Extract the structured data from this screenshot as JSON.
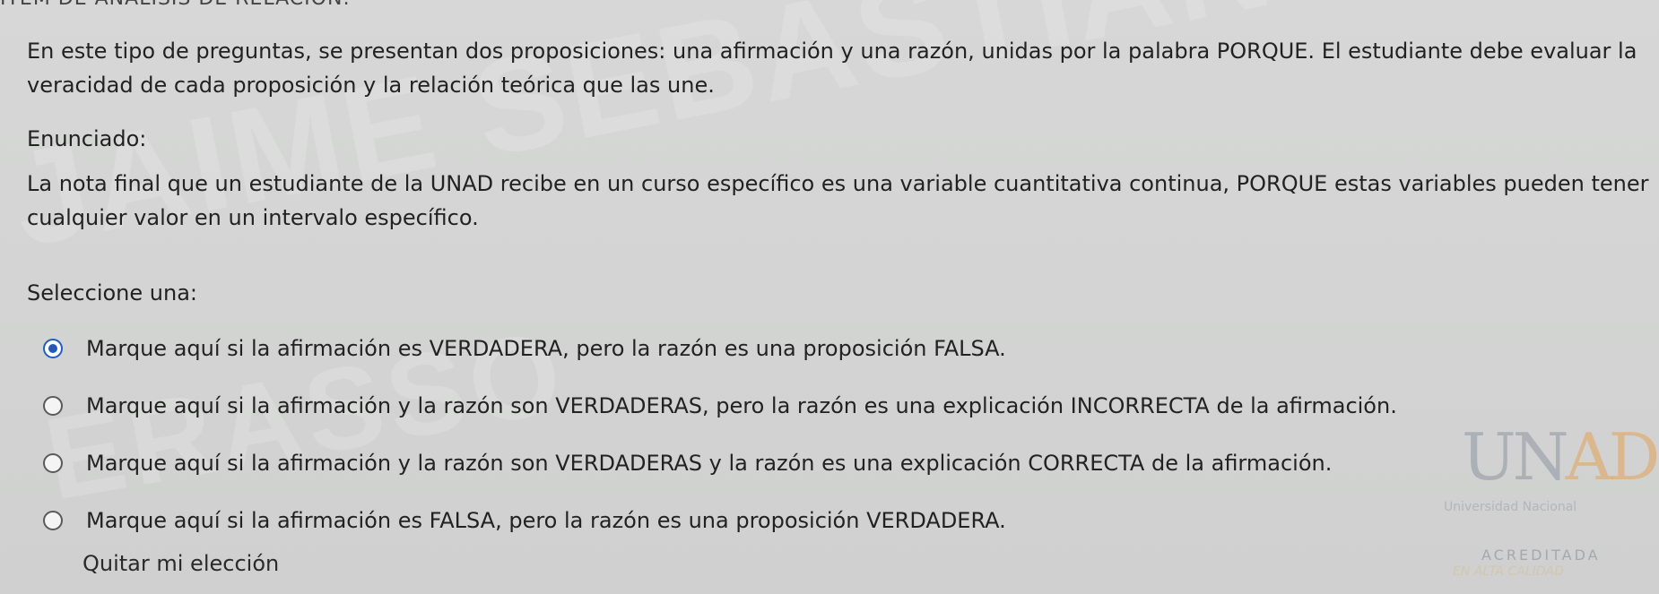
{
  "header": {
    "cut_title": "ÍTEM DE ANÁLISIS DE RELACIÓN:"
  },
  "intro_text": "En este tipo de preguntas, se presentan dos proposiciones: una afirmación y una razón, unidas por la palabra PORQUE. El estudiante debe evaluar la veracidad de cada proposición y la relación teórica que las une.",
  "enunciado_label": "Enunciado:",
  "statement": "La nota final que un estudiante de la UNAD recibe en un curso específico es una variable cuantitativa continua, PORQUE estas variables pueden tener cualquier valor en un intervalo específico.",
  "select_label": "Seleccione una:",
  "options": [
    {
      "label": "Marque aquí si la afirmación es VERDADERA, pero la razón es una proposición FALSA.",
      "selected": true
    },
    {
      "label": "Marque aquí si la afirmación y la razón son VERDADERAS, pero la razón es una explicación INCORRECTA de la afirmación.",
      "selected": false
    },
    {
      "label": "Marque aquí si la afirmación y la razón son VERDADERAS y la razón es una explicación CORRECTA de la afirmación.",
      "selected": false
    },
    {
      "label": "Marque aquí si la afirmación es FALSA, pero la razón es una proposición VERDADERA.",
      "selected": false
    }
  ],
  "clear_choice": "Quitar mi elección",
  "watermark": {
    "line1": "JAIME SEBASTIAN CASTILLO",
    "line2": "ERASSO"
  },
  "logo": {
    "letters_main": "UN",
    "letters_accent": "AD",
    "subtitle": "Universidad Nacional",
    "acreditada": "ACREDITADA",
    "calidad": "EN ALTA CALIDAD"
  },
  "colors": {
    "background": "#d4d5d4",
    "text": "#222222",
    "radio_selected": "#2559b8"
  }
}
